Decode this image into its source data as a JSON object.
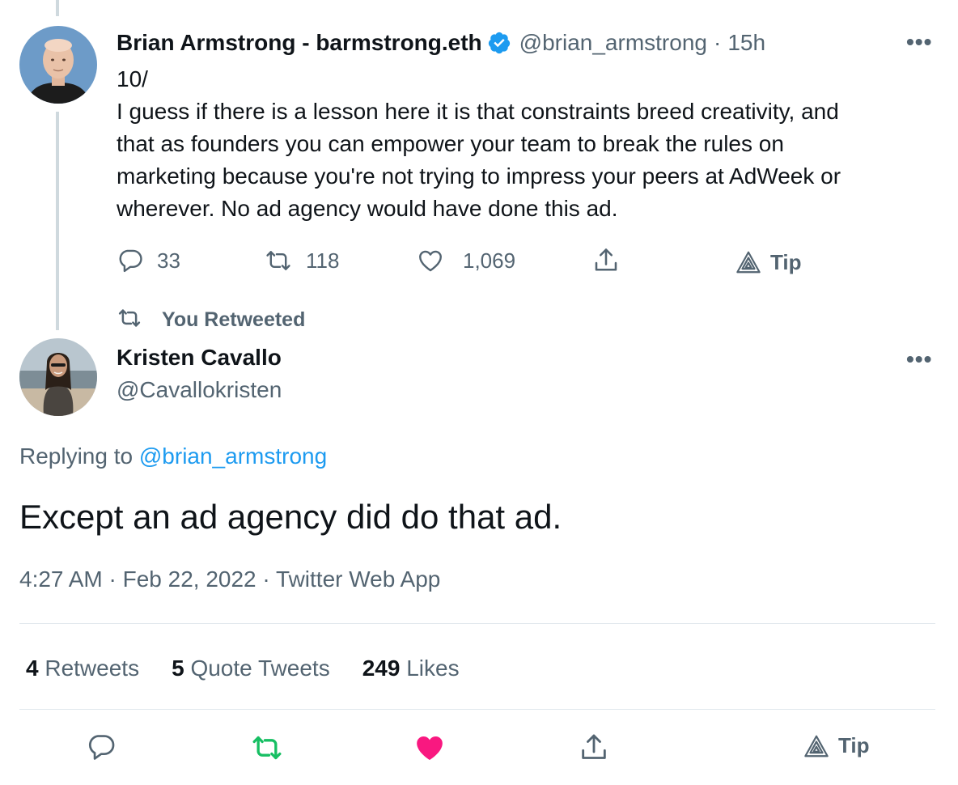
{
  "parent_tweet": {
    "author_name": "Brian Armstrong - barmstrong.eth",
    "handle": "@brian_armstrong",
    "separator": "·",
    "time_ago": "15h",
    "text_lines": [
      "10/",
      "I guess if there is a lesson here it is that constraints breed creativity, and",
      "that as founders you can empower your team to break the rules on",
      "marketing because you're not trying to impress your peers at AdWeek or",
      "wherever. No ad agency would have done this ad."
    ],
    "actions": {
      "replies": "33",
      "retweets": "118",
      "likes": "1,069",
      "tip_label": "Tip"
    },
    "verified_icon": "verified-badge-icon"
  },
  "retweet_context": {
    "label": "You Retweeted"
  },
  "main_tweet": {
    "author_name": "Kristen Cavallo",
    "handle": "@Cavallokristen",
    "replying_prefix": "Replying to",
    "replying_handle": "@brian_armstrong",
    "text": "Except an ad agency did do that ad.",
    "meta": "4:27 AM · Feb 22, 2022 · Twitter Web App",
    "stats": {
      "retweets_count": "4",
      "retweets_label": "Retweets",
      "quotes_count": "5",
      "quotes_label": "Quote Tweets",
      "likes_count": "249",
      "likes_label": "Likes"
    },
    "actions": {
      "tip_label": "Tip"
    },
    "more_label": "•••"
  },
  "colors": {
    "retweet_active": "#17bf63",
    "like_active": "#f91880",
    "link": "#1d9bf0",
    "muted": "#536471",
    "verified": "#1d9bf0"
  }
}
